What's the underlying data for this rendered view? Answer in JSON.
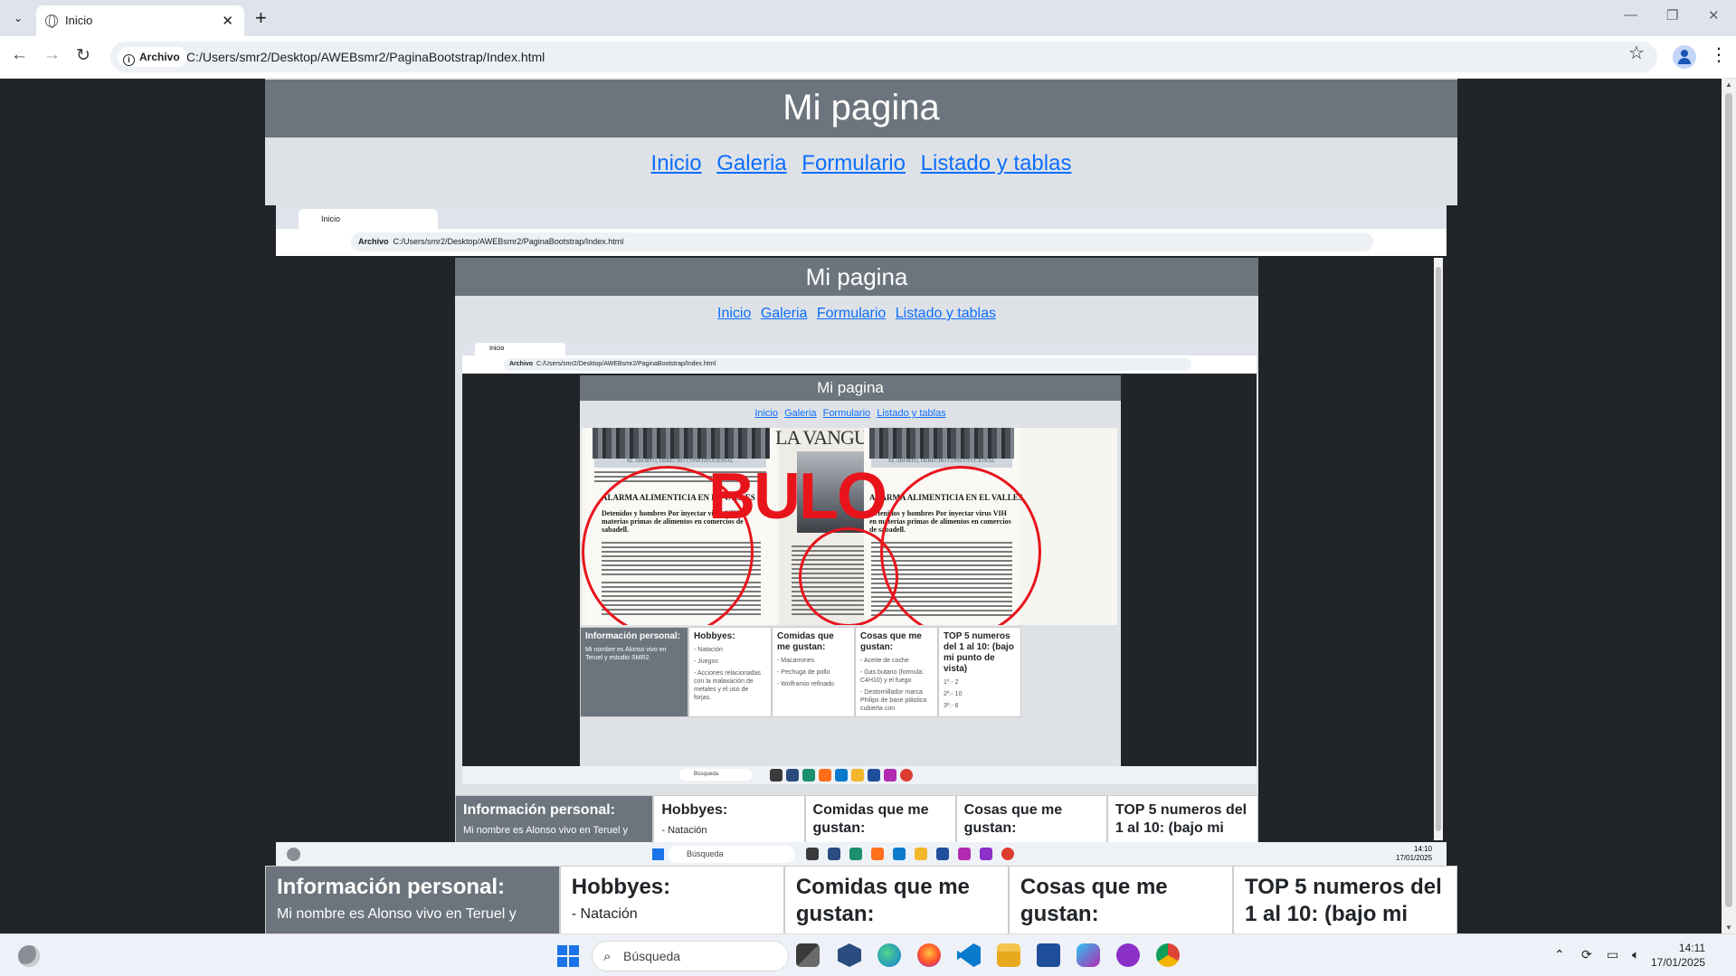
{
  "browser": {
    "tab_title": "Inicio",
    "tab_list_icon": "chevron-down-icon",
    "new_tab_label": "+",
    "minimize": "—",
    "restore": "❐",
    "close": "✕",
    "back": "←",
    "forward": "→",
    "reload": "↻",
    "site_chip": "Archivo",
    "url": "C:/Users/smr2/Desktop/AWEBsmr2/PaginaBootstrap/Index.html",
    "star": "☆",
    "menu": "⋮"
  },
  "page": {
    "title": "Mi pagina",
    "nav": [
      "Inicio",
      "Galeria",
      "Formulario",
      "Listado y tablas"
    ],
    "cards": [
      {
        "title": "Información personal:",
        "text": "Mi nombre es Alonso vivo en Teruel y"
      },
      {
        "title": "Hobbyes:",
        "text": "- Natación"
      },
      {
        "title": "Comidas que me gustan:",
        "text": ""
      },
      {
        "title": "Cosas que me gustan:",
        "text": ""
      },
      {
        "title": "TOP 5 numeros del 1 al 10: (bajo mi",
        "text": ""
      }
    ]
  },
  "nested1": {
    "title": "Mi pagina",
    "nav": [
      "Inicio",
      "Galeria",
      "Formulario",
      "Listado y tablas"
    ],
    "tab_title": "Inicio",
    "site_chip": "Archivo",
    "url": "C:/Users/smr2/Desktop/AWEBsmr2/PaginaBootstrap/Index.html",
    "cards": [
      {
        "title": "Información personal:",
        "text": "Mi nombre es Alonso vivo en Teruel y"
      },
      {
        "title": "Hobbyes:",
        "text": "- Natación"
      },
      {
        "title": "Comidas que me gustan:",
        "text": ""
      },
      {
        "title": "Cosas que me gustan:",
        "text": ""
      },
      {
        "title": "TOP 5 numeros del 1 al 10: (bajo mi",
        "text": ""
      }
    ],
    "search": "Búsqueda",
    "time": "14:10",
    "date": "17/01/2025"
  },
  "nested2": {
    "title": "Mi pagina",
    "nav": [
      "Inicio",
      "Galeria",
      "Formulario",
      "Listado y tablas"
    ],
    "tab_title": "Inicio",
    "site_chip": "Archivo",
    "url": "C:/Users/smr2/Desktop/AWEBsmr2/PaginaBootstrap/Index.html",
    "image": {
      "masthead": "LA VANGUARDIA",
      "stamp": "BULO",
      "headline": "ALARMA ALIMENTICIA EN EL VALLES",
      "subhead": "Detenidos y hombres Por inyectar virus VIH en materias primas de alimentos en comercios de sabadell.",
      "banner": "EL ABORTO, DERECHO CONSTITUCIONAL"
    },
    "cards": [
      {
        "title": "Información personal:",
        "lines": [
          "Mi nombre es Alonso vivo en Teruel y estudio SMR2."
        ]
      },
      {
        "title": "Hobbyes:",
        "lines": [
          "- Natación",
          "- Juegos",
          "- Acciones relacionadas con la malaxación de metales y el uso de forjas."
        ]
      },
      {
        "title": "Comidas que me gustan:",
        "lines": [
          "- Macarrones",
          "- Pechuga de pollo",
          "- Wolframio refinado"
        ]
      },
      {
        "title": "Cosas que me gustan:",
        "lines": [
          "- Aceite de coche",
          "- Gas butano (formula: C4H10) y el fuego",
          "- Destornillador marca Philips de base plástica cubierta con"
        ]
      },
      {
        "title": "TOP 5 numeros del 1 al 10: (bajo mi punto de vista)",
        "lines": [
          "1º.- 2",
          "2º.- 10",
          "3º.- 6"
        ]
      }
    ],
    "search": "Búsqueda"
  },
  "taskbar": {
    "search_placeholder": "Búsqueda",
    "time": "14:11",
    "date": "17/01/2025",
    "icons": [
      "file-explorer-icon",
      "3d-viewer-icon",
      "edge-icon",
      "firefox-icon",
      "vscode-icon",
      "folder-icon",
      "store-icon",
      "copilot-icon",
      "game-icon",
      "chrome-icon"
    ]
  }
}
